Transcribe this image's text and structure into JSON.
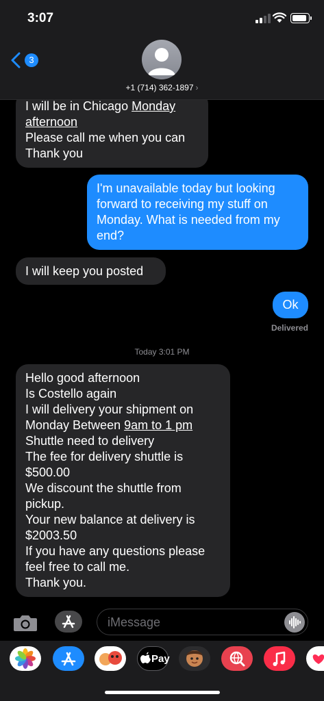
{
  "status_bar": {
    "time": "3:07"
  },
  "header": {
    "back_badge": "3",
    "contact": "+1 (714) 362-1897",
    "chevron": "›"
  },
  "messages": {
    "m1": {
      "l1a": "I will be in Chicago ",
      "l1b": "Monday",
      "l2": "afternoon",
      "l3": "Please call me when you can",
      "l4": "Thank you"
    },
    "m2": {
      "l1": "I'm unavailable today but looking",
      "l2": "forward to receiving my stuff on",
      "l3": "Monday. What is needed from my",
      "l4": "end?"
    },
    "m3": {
      "l1": "I will keep you posted"
    },
    "m4": {
      "l1": "Ok"
    },
    "delivered": "Delivered",
    "timestamp": "Today 3:01 PM",
    "m5": {
      "l1": "Hello good afternoon",
      "l2": "Is Costello again",
      "l3": "I will delivery your shipment on",
      "l4a": "Monday Between ",
      "l4b": "9am to 1 pm",
      "l5": "Shuttle need to delivery",
      "l6": "The fee for delivery shuttle is",
      "l7": "$500.00",
      "l8": "We discount the shuttle from",
      "l9": "pickup.",
      "l10": "Your new balance at delivery is",
      "l11": "$2003.50",
      "l12": "If you have any questions please",
      "l13": "feel free to call me.",
      "l14": "Thank you."
    }
  },
  "input": {
    "placeholder": "iMessage"
  },
  "app_strip": {
    "apple_pay_label": "Pay"
  },
  "colors": {
    "outgoing": "#1e8cff",
    "incoming": "#262628",
    "background": "#000000"
  }
}
